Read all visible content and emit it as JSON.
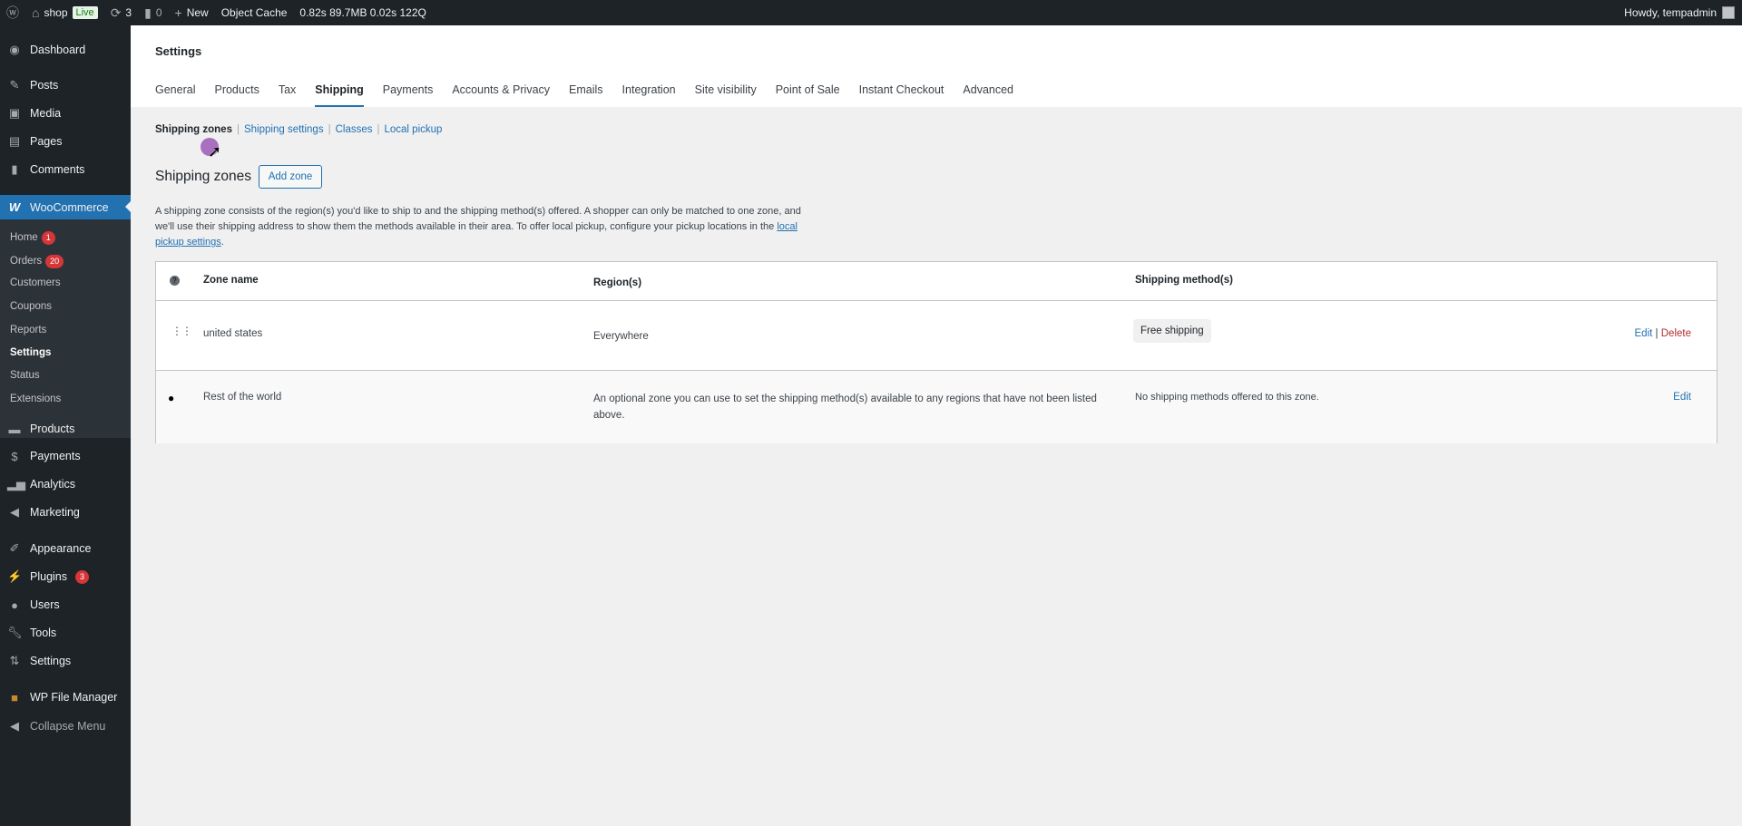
{
  "adminbar": {
    "site": "shop",
    "live": "Live",
    "updates": "3",
    "comments": "0",
    "new": "New",
    "object_cache": "Object Cache",
    "stats": "0.82s 89.7MB 0.02s 122Q",
    "howdy": "Howdy, tempadmin"
  },
  "sidebar": {
    "items": [
      "Dashboard",
      "Posts",
      "Media",
      "Pages",
      "Comments",
      "WooCommerce",
      "Products",
      "Payments",
      "Analytics",
      "Marketing",
      "Appearance",
      "Plugins",
      "Users",
      "Tools",
      "Settings",
      "WP File Manager",
      "Collapse Menu"
    ],
    "plugins_badge": "3",
    "submenu": [
      "Home",
      "Orders",
      "Customers",
      "Coupons",
      "Reports",
      "Settings",
      "Status",
      "Extensions"
    ],
    "home_badge": "1",
    "orders_badge": "20"
  },
  "header": {
    "title": "Settings",
    "tabs": [
      "General",
      "Products",
      "Tax",
      "Shipping",
      "Payments",
      "Accounts & Privacy",
      "Emails",
      "Integration",
      "Site visibility",
      "Point of Sale",
      "Instant Checkout",
      "Advanced"
    ]
  },
  "subnav": {
    "items": [
      "Shipping zones",
      "Shipping settings",
      "Classes",
      "Local pickup"
    ],
    "sep": "|"
  },
  "zones": {
    "heading": "Shipping zones",
    "add_zone": "Add zone",
    "desc": "A shipping zone consists of the region(s) you'd like to ship to and the shipping method(s) offered. A shopper can only be matched to one zone, and we'll use their shipping address to show them the methods available in their area. To offer local pickup, configure your pickup locations in the ",
    "desc_link": "local pickup settings",
    "desc_end": ".",
    "columns": [
      "Zone name",
      "Region(s)",
      "Shipping method(s)"
    ],
    "rows": [
      {
        "name": "united states",
        "region": "Everywhere",
        "method": "Free shipping",
        "edit": "Edit",
        "sep": "|",
        "delete": "Delete"
      },
      {
        "name": "Rest of the world",
        "region": "An optional zone you can use to set the shipping method(s) available to any regions that have not been listed above.",
        "method": "No shipping methods offered to this zone.",
        "edit": "Edit"
      }
    ]
  }
}
